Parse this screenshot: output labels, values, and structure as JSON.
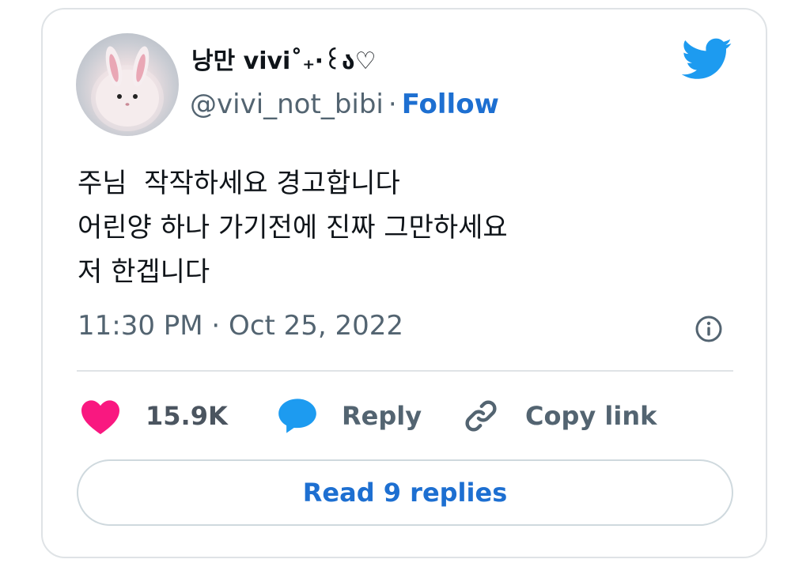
{
  "author": {
    "display_name": "낭만 vivi˚₊‧꒰ა♡",
    "handle": "@vivi_not_bibi",
    "separator": "·",
    "follow_label": "Follow"
  },
  "tweet": {
    "text": "주님  작작하세요 경고합니다\n어린양 하나 가기전에 진짜 그만하세요\n저 한겝니다",
    "timestamp": "11:30 PM · Oct 25, 2022"
  },
  "actions": {
    "likes_count": "15.9K",
    "reply_label": "Reply",
    "copy_link_label": "Copy link"
  },
  "read_replies_label": "Read 9 replies",
  "colors": {
    "twitter_blue": "#1d9bf0",
    "link_blue": "#1d6fd1",
    "heart_pink": "#f91880",
    "text_primary": "#0f1419",
    "text_secondary": "#536471"
  },
  "icons": [
    "twitter-bird-icon",
    "info-icon",
    "heart-icon",
    "reply-bubble-icon",
    "link-icon"
  ]
}
